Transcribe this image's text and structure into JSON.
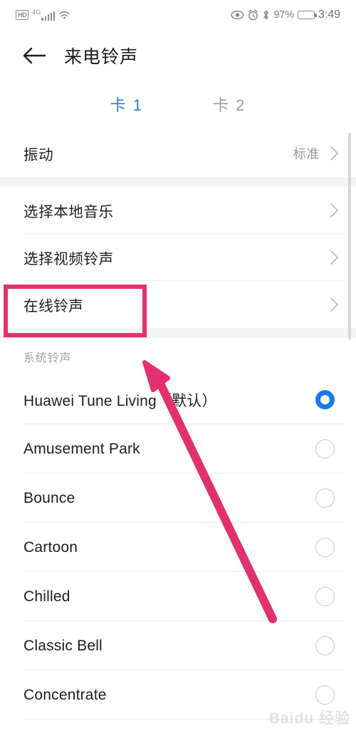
{
  "statusbar": {
    "hd_badge": "HD",
    "network_type": "4G",
    "signal_icon": "signal-bars-icon",
    "wifi_icon": "wifi-icon",
    "eye_icon": "eye-icon",
    "alarm_icon": "alarm-clock-icon",
    "bluetooth_icon": "bluetooth-icon",
    "battery_percent": "97%",
    "battery_icon": "battery-icon",
    "time": "3:49"
  },
  "appbar": {
    "back_icon": "back-arrow-icon",
    "title": "来电铃声"
  },
  "tabs": [
    {
      "label": "卡 1",
      "active": true
    },
    {
      "label": "卡 2",
      "active": false
    }
  ],
  "vibration": {
    "label": "振动",
    "value": "标准",
    "chevron_icon": "chevron-right-icon"
  },
  "menu": [
    {
      "label": "选择本地音乐",
      "chevron_icon": "chevron-right-icon"
    },
    {
      "label": "选择视频铃声",
      "chevron_icon": "chevron-right-icon"
    },
    {
      "label": "在线铃声",
      "chevron_icon": "chevron-right-icon",
      "highlighted": true
    }
  ],
  "system_section": {
    "header": "系统铃声",
    "tones": [
      {
        "name": "Huawei Tune Living（默认）",
        "selected": true
      },
      {
        "name": "Amusement Park",
        "selected": false
      },
      {
        "name": "Bounce",
        "selected": false
      },
      {
        "name": "Cartoon",
        "selected": false
      },
      {
        "name": "Chilled",
        "selected": false
      },
      {
        "name": "Classic Bell",
        "selected": false
      },
      {
        "name": "Concentrate",
        "selected": false
      }
    ]
  },
  "annotations": {
    "highlight_color": "#e2316f",
    "arrow_color": "#e2316f",
    "arrow_target": "在线铃声",
    "accent_blue": "#1a7ae8",
    "tab_blue": "#2a7fd4"
  },
  "watermark": {
    "text": "Baidu 经验"
  }
}
